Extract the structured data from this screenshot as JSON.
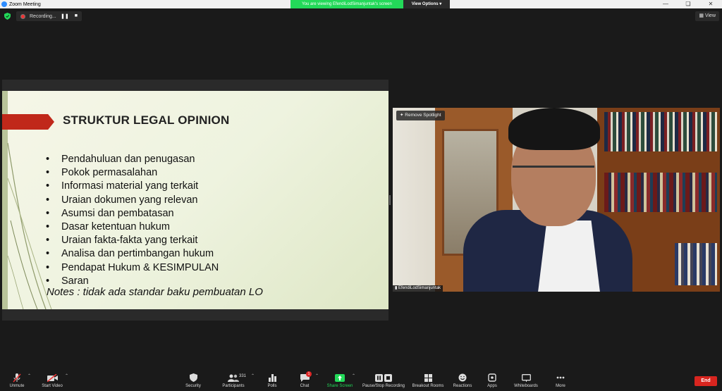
{
  "window": {
    "title": "Zoom Meeting"
  },
  "share_banner": {
    "text": "You are viewing EfendiLodSimanjuntak's screen",
    "view_options": "View Options"
  },
  "top": {
    "recording_label": "Recording...",
    "view_button": "View"
  },
  "slide": {
    "title": "STRUKTUR LEGAL OPINION",
    "bullet": "•",
    "items": [
      "Pendahuluan dan penugasan",
      "Pokok permasalahan",
      "Informasi material yang terkait",
      "Uraian dokumen yang relevan",
      "Asumsi dan pembatasan",
      "Dasar ketentuan hukum",
      "Uraian fakta-fakta yang terkait",
      "Analisa dan pertimbangan hukum",
      "Pendapat Hukum & KESIMPULAN",
      "Saran"
    ],
    "notes": "Notes : tidak ada standar baku pembuatan LO",
    "accent_color": "#c0281a"
  },
  "video": {
    "spotlight_label": "Remove Spotlight",
    "participant_name": "EfendiLodSimanjuntak"
  },
  "toolbar": {
    "unmute": "Unmute",
    "start_video": "Start Video",
    "security": "Security",
    "participants": "Participants",
    "participants_count": "331",
    "polls": "Polls",
    "chat": "Chat",
    "chat_badge": "1",
    "share_screen": "Share Screen",
    "pause_recording": "Pause/Stop Recording",
    "breakout_rooms": "Breakout Rooms",
    "reactions": "Reactions",
    "apps": "Apps",
    "whiteboards": "Whiteboards",
    "more": "More",
    "end": "End"
  },
  "colors": {
    "share_green": "#23d959",
    "end_red": "#d8251f",
    "background": "#1a1a1a"
  }
}
